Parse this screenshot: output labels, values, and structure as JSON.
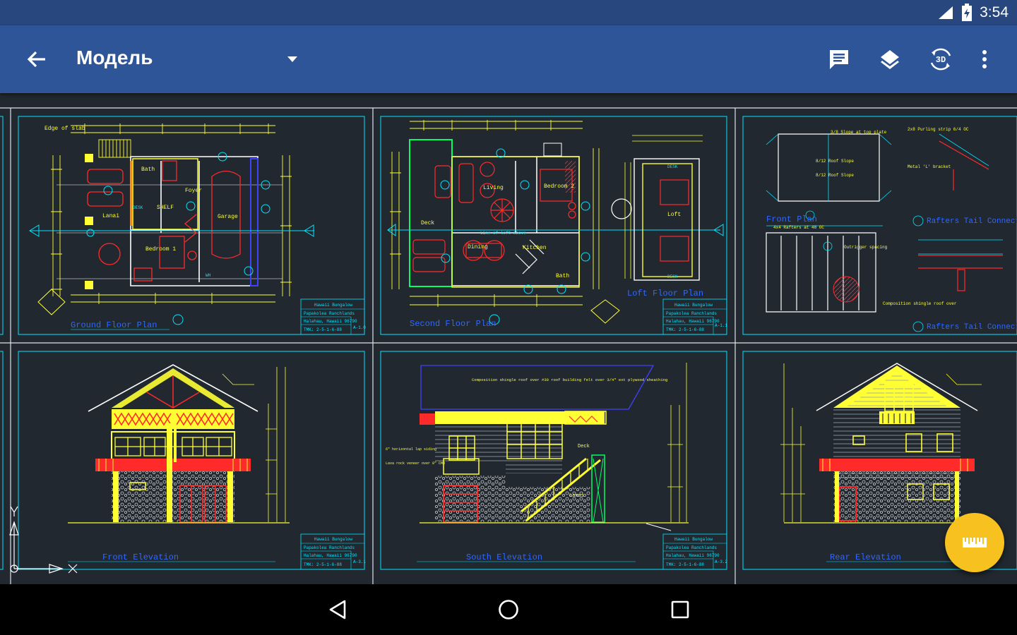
{
  "status_bar": {
    "time": "3:54",
    "icons": [
      "wifi-icon",
      "battery-charging-icon"
    ]
  },
  "app_bar": {
    "title": "Модель",
    "back_icon": "arrow-back-icon",
    "dropdown_icon": "triangle-down-icon",
    "actions": [
      {
        "name": "comments",
        "icon": "comment-icon"
      },
      {
        "name": "layers",
        "icon": "layers-icon"
      },
      {
        "name": "3d-view",
        "icon": "rotate-3d-icon",
        "label": "3D"
      },
      {
        "name": "more",
        "icon": "more-vert-icon"
      }
    ]
  },
  "drawing": {
    "sheets": [
      {
        "title": "Ground Floor Plan",
        "project": "Hawaii Bungalow",
        "client": "Papakolea Ranchlands",
        "address": "Halahau, Hawaii 96790",
        "tmk": "TMK: 2-5-1-6-88",
        "sheet_no": "A-1.0"
      },
      {
        "title": "Second Floor Plan",
        "project": "Hawaii Bungalow",
        "client": "Papakolea Ranchlands",
        "address": "Halahau, Hawaii 96790",
        "tmk": "TMK: 2-5-1-6-88",
        "sheet_no": "A-1.1"
      },
      {
        "title": "Loft Floor Plan"
      },
      {
        "title": "Front Plan",
        "note1": "Rafters Tail Connection",
        "note2": "Rafters Tail Connection"
      },
      {
        "title": "Front Elevation",
        "project": "Hawaii Bungalow",
        "client": "Papakolea Ranchlands",
        "address": "Halahau, Hawaii 96790",
        "tmk": "TMK: 2-5-1-6-88",
        "sheet_no": "A-3.1"
      },
      {
        "title": "South Elevation",
        "project": "Hawaii Bungalow",
        "client": "Papakolea Ranchlands",
        "address": "Halahau, Hawaii 96790",
        "tmk": "TMK: 2-5-1-6-88",
        "sheet_no": "A-3.2"
      },
      {
        "title": "Rear Elevation"
      }
    ],
    "rooms": [
      "Bath",
      "Lanai",
      "Garage",
      "Bedroom 1",
      "Deck",
      "Living",
      "Bedroom 2",
      "Dining",
      "Kitchen",
      "Bath",
      "Loft",
      "Deck",
      "Lanai"
    ]
  },
  "fab": {
    "icon": "ruler-icon"
  },
  "nav": [
    "back-triangle-icon",
    "home-circle-icon",
    "recents-square-icon"
  ]
}
